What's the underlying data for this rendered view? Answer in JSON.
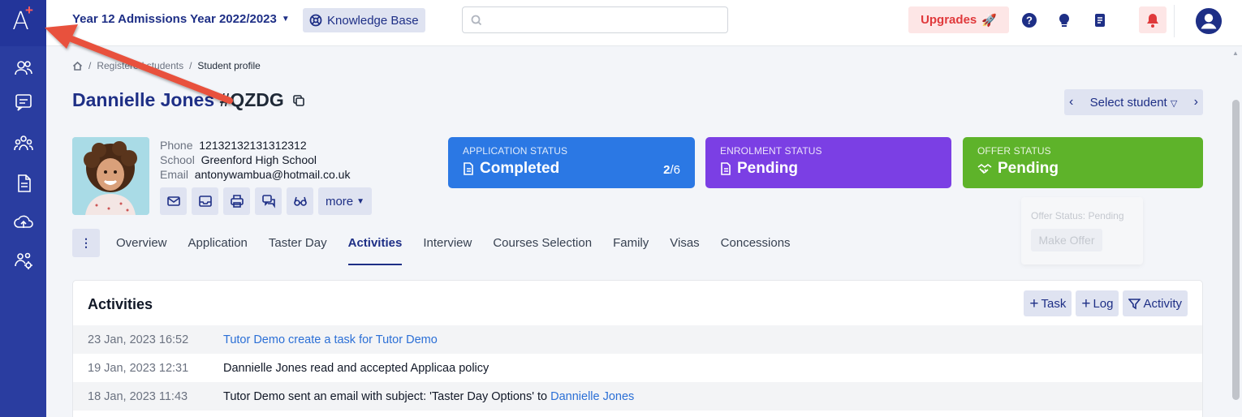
{
  "topbar": {
    "year_label": "Year 12 Admissions Year 2022/2023",
    "kb_label": "Knowledge Base",
    "search_placeholder": "",
    "upgrades_label": "Upgrades"
  },
  "breadcrumb": [
    "Registered students",
    "Student profile"
  ],
  "student": {
    "name": "Dannielle Jones",
    "code": "#QZDG",
    "phone_label": "Phone",
    "phone": "12132132131312312",
    "school_label": "School",
    "school": "Greenford High School",
    "email_label": "Email",
    "email": "antonywambua@hotmail.co.uk",
    "more_label": "more"
  },
  "select_student_label": "Select student",
  "status_cards": {
    "application": {
      "label": "APPLICATION STATUS",
      "value": "Completed",
      "count_done": "2",
      "count_total": "/6"
    },
    "enrolment": {
      "label": "ENROLMENT STATUS",
      "value": "Pending"
    },
    "offer": {
      "label": "OFFER STATUS",
      "value": "Pending"
    }
  },
  "offer_popover": {
    "text": "Offer Status: Pending",
    "button": "Make Offer"
  },
  "tabs": [
    "Overview",
    "Application",
    "Taster Day",
    "Activities",
    "Interview",
    "Courses Selection",
    "Family",
    "Visas",
    "Concessions"
  ],
  "active_tab": "Activities",
  "activities": {
    "title": "Activities",
    "buttons": {
      "task": "Task",
      "log": "Log",
      "activity": "Activity"
    },
    "rows": [
      {
        "date": "23 Jan, 2023 16:52",
        "text": "Tutor Demo create a task for Tutor Demo",
        "link_text": ""
      },
      {
        "date": "19 Jan, 2023 12:31",
        "text": "Dannielle Jones read and accepted Applicaa policy",
        "link_text": ""
      },
      {
        "date": "18 Jan, 2023 11:43",
        "text": "Tutor Demo sent an email with subject: 'Taster Day Options' to ",
        "link_text": "Dannielle Jones"
      }
    ]
  },
  "colors": {
    "sidebar": "#2a3da0",
    "brand": "#1e2f86",
    "application": "#2b78e4",
    "enrolment": "#7b3fe4",
    "offer": "#5eb32a",
    "annotation_arrow": "#e8513c"
  }
}
